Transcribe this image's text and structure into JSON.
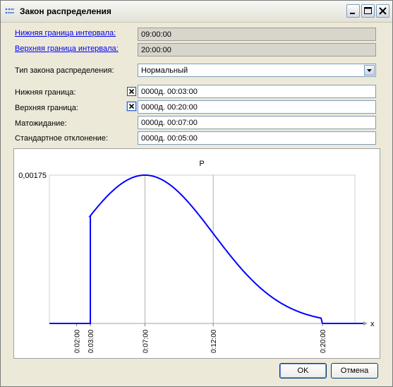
{
  "window": {
    "title": "Закон распределения",
    "icon": "app-icon"
  },
  "form": {
    "lower_interval_link": "Нижняя граница интервала:",
    "lower_interval_value": "09:00:00",
    "upper_interval_link": "Верхняя граница интервала:",
    "upper_interval_value": "20:00:00",
    "law_type_label": "Тип закона распределения:",
    "law_type_value": "Нормальный",
    "lower_bound_label": "Нижняя граница:",
    "lower_bound_value": "0000д. 00:03:00",
    "upper_bound_label": "Верхняя граница:",
    "upper_bound_value": "0000д. 00:20:00",
    "expectation_label": "Матожидание:",
    "expectation_value": "0000д. 00:07:00",
    "std_label": "Стандартное отклонение:",
    "std_value": "0000д. 00:05:00"
  },
  "chart_data": {
    "type": "line",
    "title": "P",
    "xlabel": "x",
    "ylabel": "",
    "x_unit": "minutes",
    "xlim": [
      "00:00",
      "00:23:00"
    ],
    "ylim": [
      0,
      0.00175
    ],
    "x_ticks": [
      "0:02:00",
      "0:03:00",
      "0:07:00",
      "0:12:00",
      "0:20:00"
    ],
    "y_ticks": [
      "0,00175"
    ],
    "vertical_gridlines_at": [
      "0:07:00",
      "0:12:00"
    ],
    "truncation": {
      "lower": "0:03:00",
      "upper": "0:20:00"
    },
    "distribution": {
      "family": "normal",
      "mean": "0:07:00",
      "std": "0:05:00"
    },
    "curve_color": "#0000ff"
  },
  "buttons": {
    "ok": "OK",
    "cancel": "Отмена"
  },
  "colors": {
    "link": "#0000ee",
    "curve": "#0000ff",
    "field_disabled": "#d7d5cc",
    "window_bg": "#ece9d8"
  }
}
